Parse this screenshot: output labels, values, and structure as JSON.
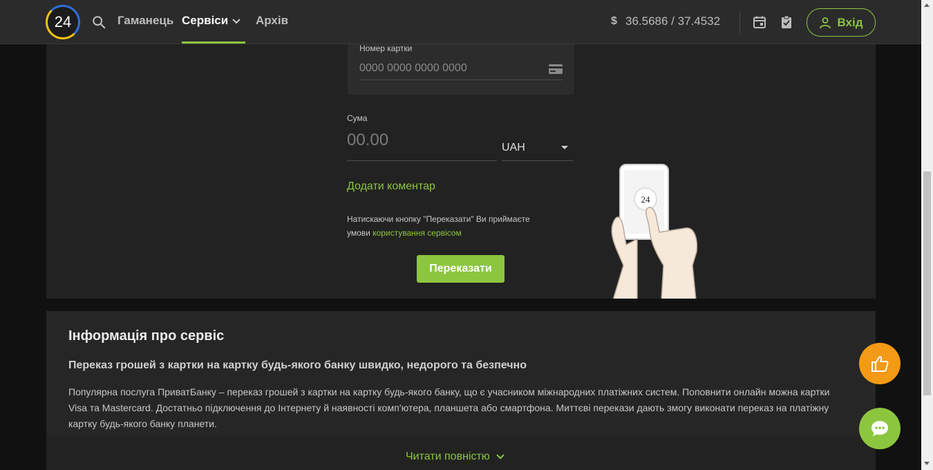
{
  "header": {
    "logo_text": "24",
    "nav": {
      "wallet": "Гаманець",
      "services": "Сервіси",
      "archive": "Архів"
    },
    "rate_symbol": "$",
    "rate": "36.5686 / 37.4532",
    "login_label": "Вхід"
  },
  "form": {
    "card_label": "Номер картки",
    "card_placeholder": "0000 0000 0000 0000",
    "sum_label": "Сума",
    "sum_placeholder": "00.00",
    "currency": "UAH",
    "add_comment": "Додати коментар",
    "terms_text": "Натискаючи кнопку \"Переказати\" Ви приймаєте умови ",
    "terms_link": "користування сервісом",
    "submit_label": "Переказати",
    "illustration_text": "24"
  },
  "info": {
    "title": "Інформація про сервіс",
    "subtitle": "Переказ грошей з картки на картку будь-якого банку швидко, недорого та безпечно",
    "body": "Популярна послуга ПриватБанку – переказ грошей з картки на картку будь-якого банку, що є учасником міжнародних платіжних систем. Поповнити онлайн можна картки Visa та Mastercard. Достатньо підключення до Інтернету й наявності комп’ютера, планшета або смартфона. Миттєві перекази дають змогу виконати переказ на платіжну картку будь-якого банку планети.",
    "read_more": "Читати повністю"
  },
  "colors": {
    "accent": "#8cc63f",
    "like_button": "#f39a16",
    "header_bg": "#2b2b2b"
  },
  "icons": [
    "search-icon",
    "chevron-down-icon",
    "dollar-icon",
    "calendar-icon",
    "clipboard-check-icon",
    "user-icon",
    "credit-card-icon",
    "thumbs-up-icon",
    "chat-icon"
  ]
}
